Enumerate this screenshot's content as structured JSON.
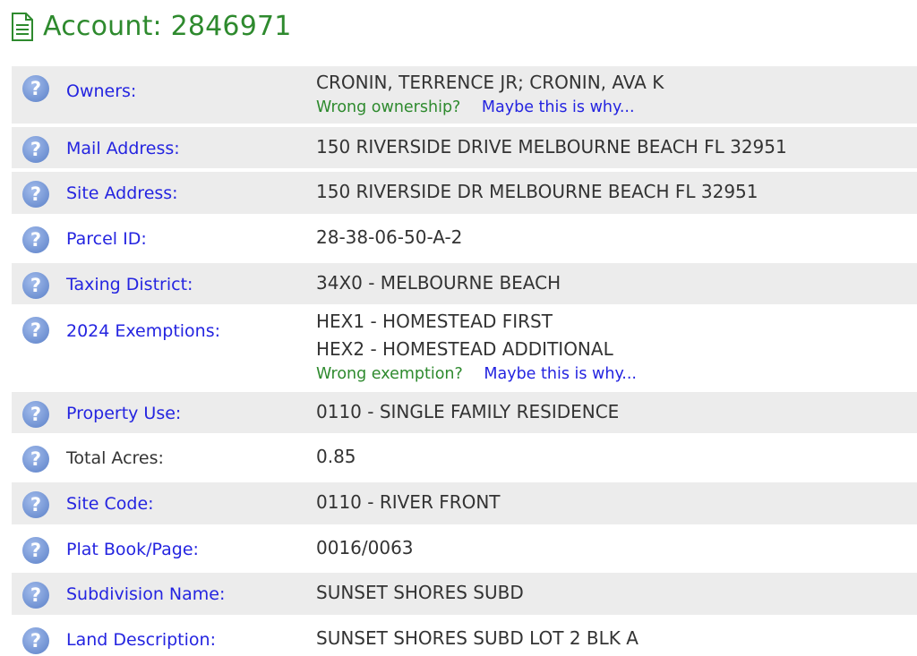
{
  "header": {
    "title": "Account: 2846971"
  },
  "rows": {
    "owners": {
      "label": "Owners:",
      "value": "CRONIN, TERRENCE JR; CRONIN, AVA K",
      "link_question": "Wrong ownership?",
      "link_answer": "Maybe this is why..."
    },
    "mail_address": {
      "label": "Mail Address:",
      "value": "150 RIVERSIDE DRIVE MELBOURNE BEACH FL 32951"
    },
    "site_address": {
      "label": "Site Address:",
      "value": "150 RIVERSIDE DR MELBOURNE BEACH FL 32951"
    },
    "parcel_id": {
      "label": "Parcel ID:",
      "value": "28-38-06-50-A-2"
    },
    "taxing_district": {
      "label": "Taxing District:",
      "value": "34X0 - MELBOURNE BEACH"
    },
    "exemptions": {
      "label": "2024 Exemptions:",
      "value_1": "HEX1 - HOMESTEAD FIRST",
      "value_2": "HEX2 - HOMESTEAD ADDITIONAL",
      "link_question": "Wrong exemption?",
      "link_answer": "Maybe this is why..."
    },
    "property_use": {
      "label": "Property Use:",
      "value": "0110 - SINGLE FAMILY RESIDENCE"
    },
    "total_acres": {
      "label": "Total Acres:",
      "value": "0.85"
    },
    "site_code": {
      "label": "Site Code:",
      "value": "0110 - RIVER FRONT"
    },
    "plat_book": {
      "label": "Plat Book/Page:",
      "value": "0016/0063"
    },
    "subdivision": {
      "label": "Subdivision Name:",
      "value": "SUNSET SHORES SUBD"
    },
    "land_description": {
      "label": "Land Description:",
      "value": "SUNSET SHORES SUBD LOT 2 BLK A"
    }
  },
  "icons": {
    "help": "question-mark-circle-icon",
    "document": "document-icon",
    "help_glyph": "?"
  },
  "colors": {
    "accent_green": "#2e8a2e",
    "link_blue": "#2424e0",
    "row_shade": "#ececec",
    "text": "#333333",
    "help_icon": "#7b9bd8"
  }
}
